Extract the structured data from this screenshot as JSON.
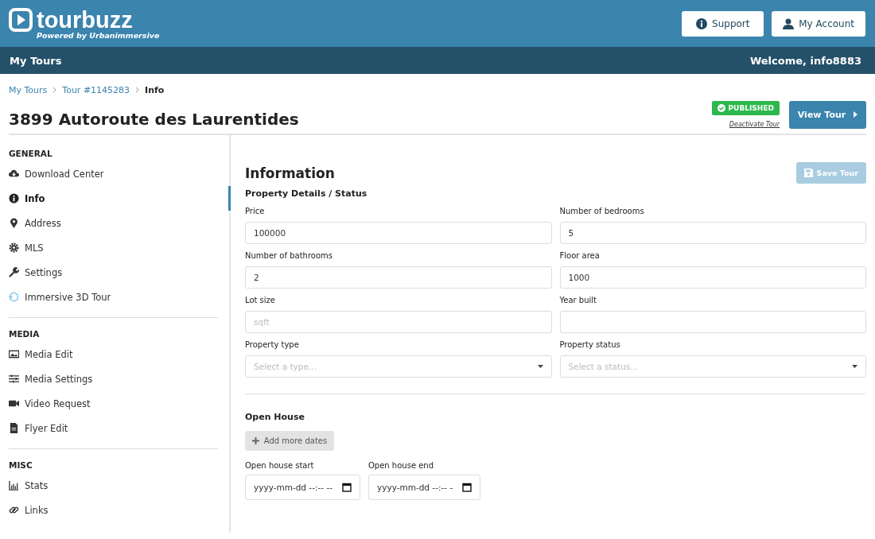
{
  "header": {
    "logo": "tourbuzz",
    "tagline": "Powered by Urbanimmersive",
    "buttons": [
      "Support",
      "My Account"
    ]
  },
  "navbar": {
    "title": "My Tours",
    "welcome": "Welcome, info8883"
  },
  "breadcrumb": [
    "My Tours",
    "Tour #1145283",
    "Info"
  ],
  "page": {
    "title": "3899 Autoroute des Laurentides",
    "status_badge": "PUBLISHED",
    "deactivate_link": "Deactivate Tour",
    "view_button": "View Tour"
  },
  "sidebar": [
    {
      "heading": "GENERAL",
      "items": [
        {
          "label": "Download Center",
          "selected": false
        },
        {
          "label": "Info",
          "selected": true
        },
        {
          "label": "Address",
          "selected": false
        },
        {
          "label": "MLS",
          "selected": false
        },
        {
          "label": "Settings",
          "selected": false
        },
        {
          "label": "Immersive 3D Tour",
          "selected": false
        }
      ]
    },
    {
      "heading": "MEDIA",
      "items": [
        {
          "label": "Media Edit",
          "selected": false
        },
        {
          "label": "Media Settings",
          "selected": false
        },
        {
          "label": "Video Request",
          "selected": false
        },
        {
          "label": "Flyer Edit",
          "selected": false
        }
      ]
    },
    {
      "heading": "MISC",
      "items": [
        {
          "label": "Stats",
          "selected": false
        },
        {
          "label": "Links",
          "selected": false
        }
      ]
    }
  ],
  "content": {
    "title": "Information",
    "save_button": {
      "label": "Save Tour",
      "disabled": true
    },
    "section": "Property Details / Status",
    "fields": [
      {
        "kind": "text",
        "label": "Price",
        "value": "100000"
      },
      {
        "kind": "text",
        "label": "Number of bedrooms",
        "value": "5"
      },
      {
        "kind": "text",
        "label": "Number of bathrooms",
        "value": "2"
      },
      {
        "kind": "text",
        "label": "Floor area",
        "value": "1000"
      },
      {
        "kind": "text",
        "label": "Lot size",
        "placeholder": "sqft"
      },
      {
        "kind": "text",
        "label": "Year built"
      },
      {
        "kind": "select",
        "label": "Property type",
        "placeholder": "Select a type..."
      },
      {
        "kind": "select",
        "label": "Property status",
        "placeholder": "Select a status..."
      }
    ],
    "open_house": {
      "title": "Open House",
      "add_button": "Add more dates",
      "fields": [
        {
          "label": "Open house start",
          "placeholder": "yyyy-mm-dd --:-- --"
        },
        {
          "label": "Open house end",
          "placeholder": "yyyy-mm-dd --:-- -"
        }
      ]
    }
  }
}
